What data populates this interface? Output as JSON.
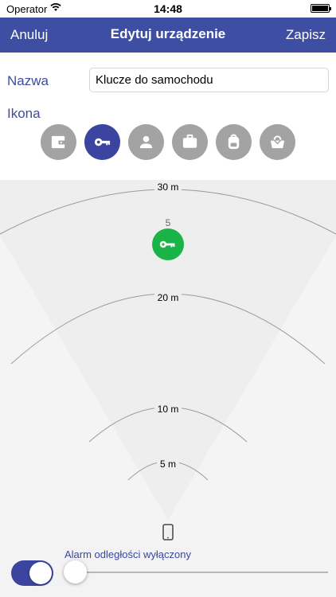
{
  "status_bar": {
    "carrier": "Operator",
    "time": "14:48"
  },
  "nav": {
    "cancel_label": "Anuluj",
    "title": "Edytuj urządzenie",
    "save_label": "Zapisz"
  },
  "form": {
    "name_label": "Nazwa",
    "name_value": "Klucze do samochodu",
    "icon_label": "Ikona",
    "icons": [
      {
        "name": "wallet-icon",
        "selected": false
      },
      {
        "name": "key-icon",
        "selected": true
      },
      {
        "name": "person-icon",
        "selected": false
      },
      {
        "name": "briefcase-icon",
        "selected": false
      },
      {
        "name": "backpack-icon",
        "selected": false
      },
      {
        "name": "handbag-icon",
        "selected": false
      }
    ]
  },
  "radar": {
    "rings": [
      "30 m",
      "20 m",
      "10 m",
      "5 m"
    ],
    "device_count": "5",
    "device_icon": "key-icon",
    "device_color": "#1ab347",
    "phone_icon": "phone-icon"
  },
  "alarm": {
    "label": "Alarm odległości wyłączony",
    "toggle_on": true,
    "slider_value": 0
  },
  "colors": {
    "accent": "#3e4fa3",
    "icon_inactive": "#a3a3a3",
    "icon_selected": "#3b45a0"
  }
}
